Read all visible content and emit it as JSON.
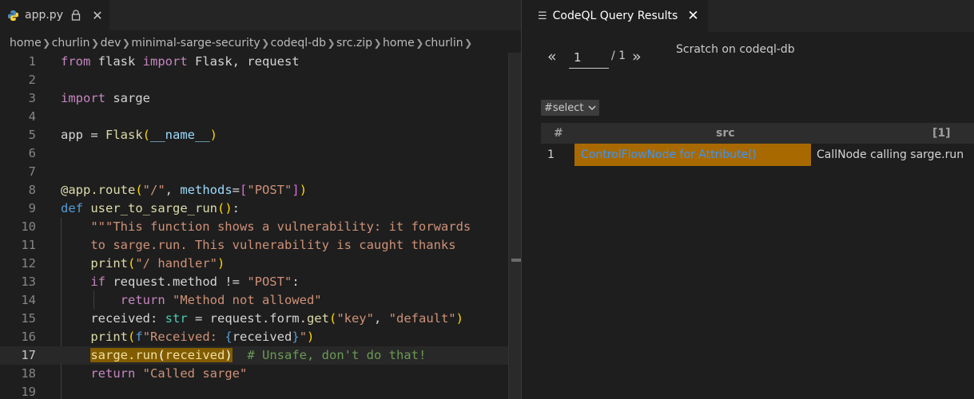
{
  "editor": {
    "tab_label": "app.py",
    "breadcrumb": [
      "home",
      "churlin",
      "dev",
      "minimal-sarge-security",
      "codeql-db",
      "src.zip",
      "home",
      "churlin"
    ]
  },
  "results": {
    "tab_title": "CodeQL Query Results",
    "pager": {
      "prev": "«",
      "page": "1",
      "total": "/ 1",
      "next": "»"
    },
    "database_label": "Scratch on codeql-db",
    "select_value": "#select",
    "table": {
      "headers": [
        "#",
        "src",
        "[1]"
      ],
      "rows": [
        {
          "index": "1",
          "src": "ControlFlowNode for Attribute()",
          "col1": "CallNode calling sarge.run"
        }
      ]
    }
  },
  "colors": {
    "highlight": "#825c00",
    "result_cell": "#a86a00",
    "link": "#3794ff"
  }
}
